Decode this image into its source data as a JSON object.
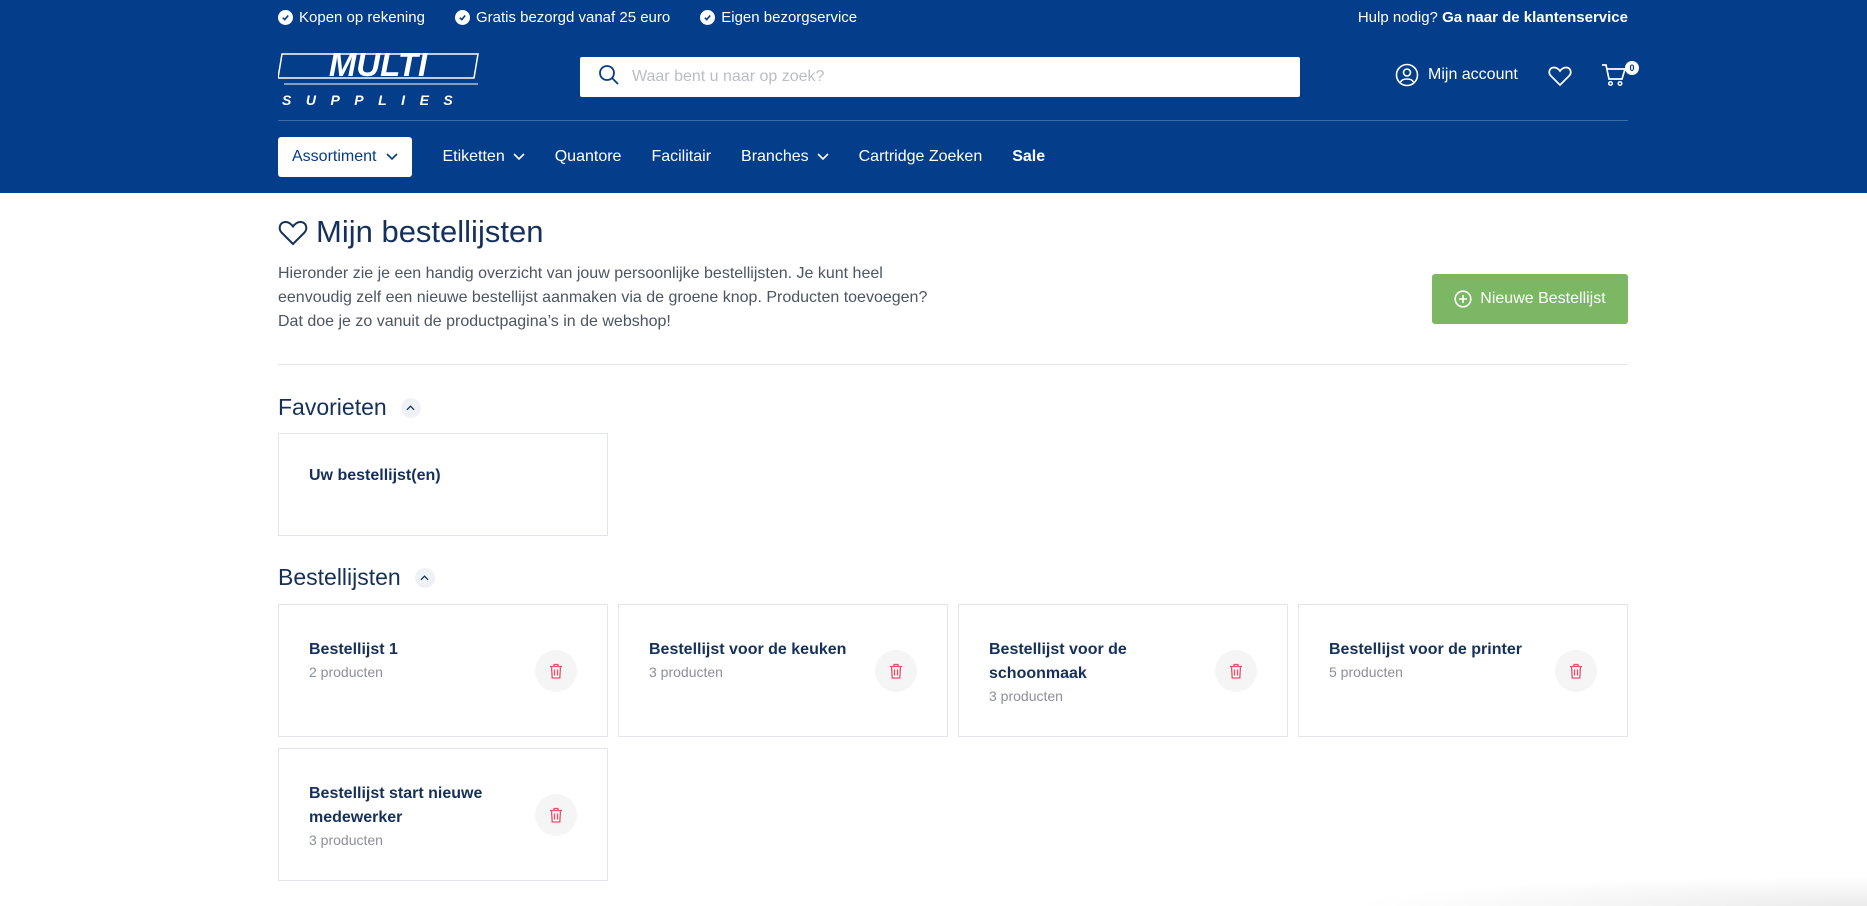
{
  "topbar": {
    "usps": [
      "Kopen op rekening",
      "Gratis bezorgd vanaf 25 euro",
      "Eigen bezorgservice"
    ],
    "help_text": "Hulp nodig?",
    "help_link": "Ga naar de klantenservice"
  },
  "logo": {
    "line1": "MULTI",
    "line2": "SUPPLIES"
  },
  "search": {
    "placeholder": "Waar bent u naar op zoek?"
  },
  "account": {
    "label": "Mijn account"
  },
  "cart": {
    "count": "0"
  },
  "nav": {
    "assortiment": "Assortiment",
    "items": [
      "Etiketten",
      "Quantore",
      "Facilitair",
      "Branches",
      "Cartridge Zoeken",
      "Sale"
    ]
  },
  "page": {
    "title": "Mijn bestellijsten",
    "intro": "Hieronder zie je een handig overzicht van jouw persoonlijke bestellijsten. Je kunt heel eenvoudig zelf een nieuwe bestellijst aanmaken via de groene knop. Producten toevoegen? Dat doe je zo vanuit de productpagina’s in de webshop!",
    "new_button": "Nieuwe Bestellijst"
  },
  "favorites": {
    "title": "Favorieten",
    "card_label": "Uw bestellijst(en)"
  },
  "lists": {
    "title": "Bestellijsten",
    "items": [
      {
        "name": "Bestellijst 1",
        "count": "2 producten"
      },
      {
        "name": "Bestellijst voor de keuken",
        "count": "3 producten"
      },
      {
        "name": "Bestellijst voor de schoonmaak",
        "count": "3 producten"
      },
      {
        "name": "Bestellijst voor de printer",
        "count": "5 producten"
      },
      {
        "name": "Bestellijst start nieuwe medewerker",
        "count": "3 producten"
      }
    ]
  },
  "colors": {
    "header_bg": "#043d8a",
    "accent_green": "#7cb863",
    "title_navy": "#15305a",
    "trash_red": "#e0556b"
  }
}
